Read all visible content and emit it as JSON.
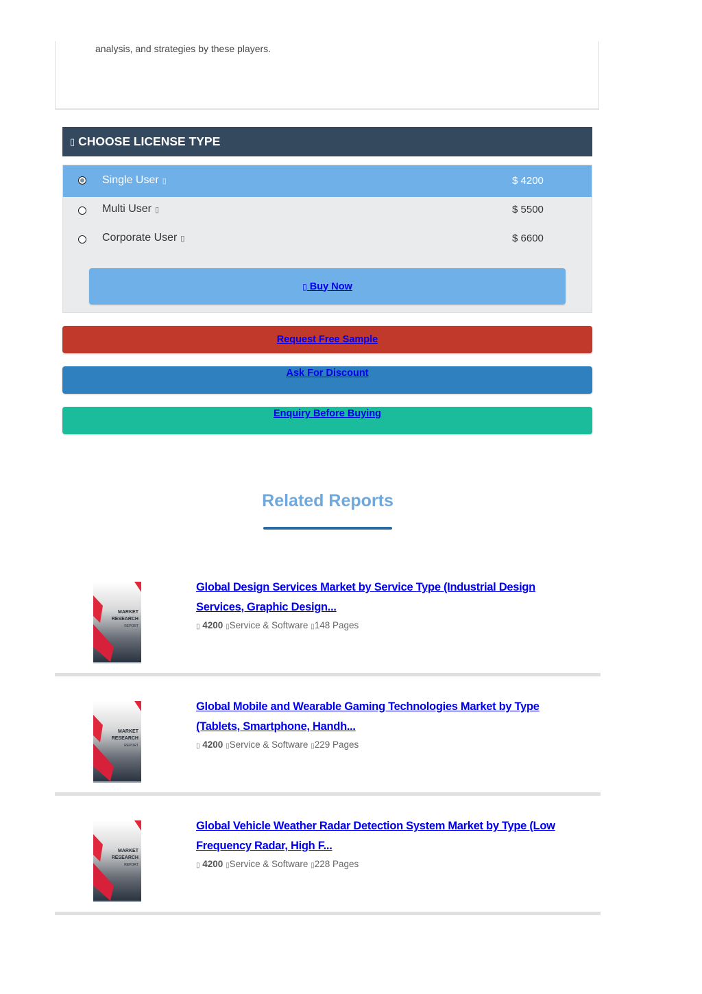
{
  "description": {
    "text": "analysis, and strategies by these players."
  },
  "license": {
    "icon": "tag-icon",
    "header": "CHOOSE LICENSE TYPE",
    "options": [
      {
        "name": "Single User",
        "price": "$ 4200",
        "selected": true
      },
      {
        "name": "Multi User",
        "price": "$ 5500",
        "selected": false
      },
      {
        "name": "Corporate User",
        "price": "$ 6600",
        "selected": false
      }
    ],
    "buy_icon": "cart-icon",
    "buy_label": "Buy Now"
  },
  "actions": {
    "sample": "Request Free Sample",
    "discount": "Ask For Discount",
    "enquiry": "Enquiry Before Buying"
  },
  "colors": {
    "header_bg": "#34495e",
    "selected_row": "#6fb0e8",
    "sample_btn": "#c0392b",
    "discount_btn": "#2e80bf",
    "enquiry_btn": "#1abc9c",
    "link": "#0000ee"
  },
  "related": {
    "title": "Related Reports",
    "cover": {
      "line1": "MARKET",
      "line2": "RESEARCH",
      "line3": "REPORT"
    },
    "reports": [
      {
        "title": "Global Design Services Market by Service Type (Industrial Design Services, Graphic Design...",
        "price": "4200",
        "category": "Service & Software",
        "pages": "148 Pages"
      },
      {
        "title": "Global Mobile and Wearable Gaming Technologies Market by Type (Tablets, Smartphone, Handh...",
        "price": "4200",
        "category": "Service & Software",
        "pages": "229 Pages"
      },
      {
        "title": "Global Vehicle Weather Radar Detection System Market by Type (Low Frequency Radar, High F...",
        "price": "4200",
        "category": "Service & Software",
        "pages": "228 Pages"
      }
    ]
  }
}
